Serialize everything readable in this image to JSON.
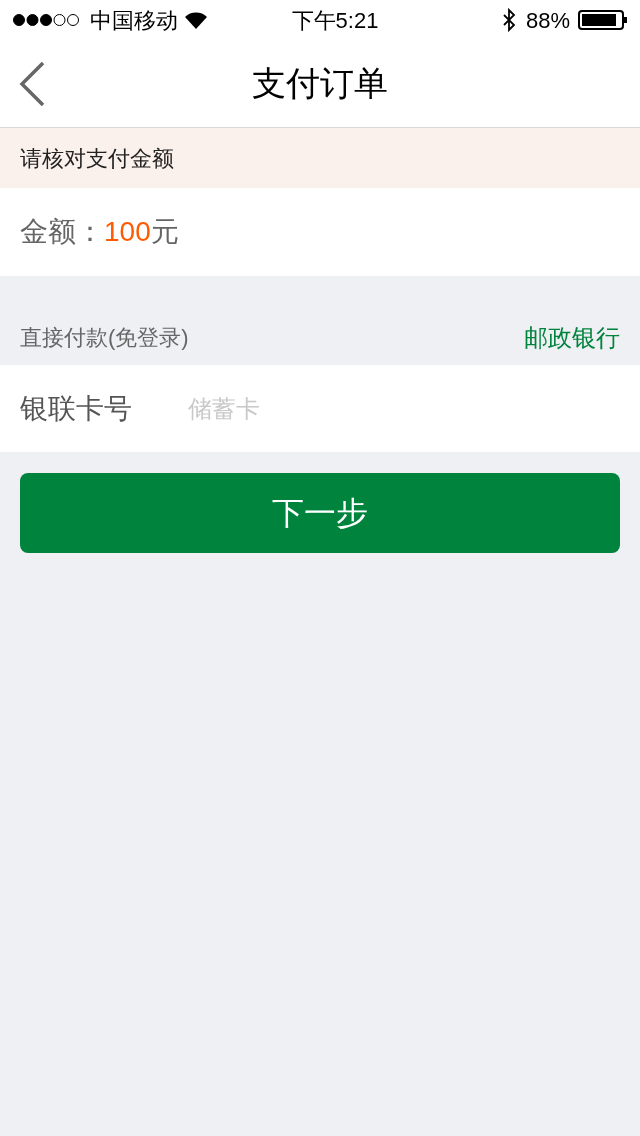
{
  "status_bar": {
    "carrier": "中国移动",
    "time": "下午5:21",
    "battery": "88%"
  },
  "nav": {
    "title": "支付订单"
  },
  "notice": "请核对支付金额",
  "amount": {
    "label": "金额：",
    "value": "100",
    "unit": "元"
  },
  "section": {
    "title": "直接付款(免登录)",
    "bank": "邮政银行"
  },
  "card_field": {
    "label": "银联卡号",
    "placeholder": "储蓄卡"
  },
  "next_button": "下一步"
}
